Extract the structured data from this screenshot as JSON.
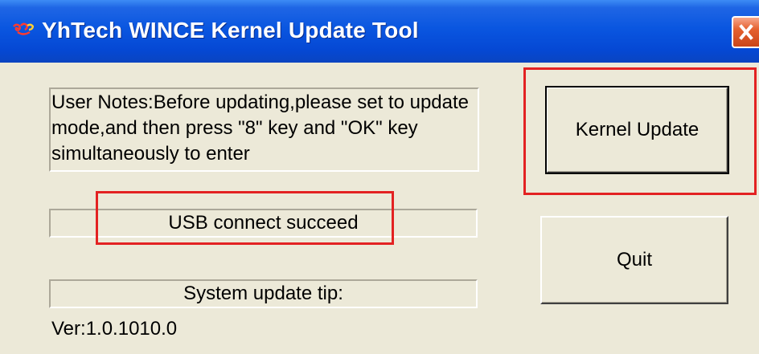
{
  "window": {
    "title": "YhTech WINCE Kernel Update Tool",
    "icon": "app-logo-icon",
    "close_icon": "close-icon"
  },
  "notes": {
    "text": "User Notes:Before updating,please set to update mode,and then press \"8\" key and \"OK\" key simultaneously to enter"
  },
  "status": {
    "text": "USB connect succeed"
  },
  "tip": {
    "text": "System update tip:"
  },
  "version": {
    "text": "Ver:1.0.1010.0"
  },
  "buttons": {
    "kernel_update": "Kernel Update",
    "quit": "Quit"
  },
  "colors": {
    "title_bar": "#0a56e0",
    "highlight": "#e32222",
    "dialog_bg": "#ece9d8"
  }
}
